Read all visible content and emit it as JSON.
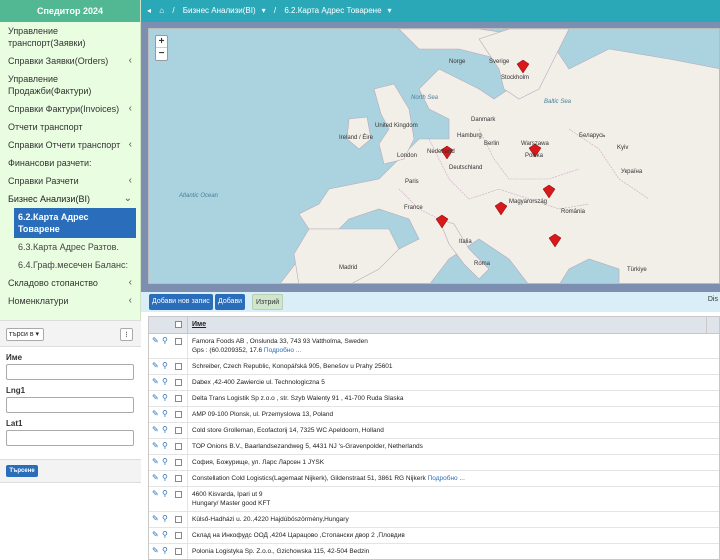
{
  "sidebar": {
    "brand": "Спедитор 2024",
    "items": [
      {
        "label": "Управление транспорт(Заявки)",
        "chevron": false
      },
      {
        "label": "Справки Заявки(Orders)",
        "chevron": true
      },
      {
        "label": "Управление Продажби(Фактури)",
        "chevron": false
      },
      {
        "label": "Справки Фактури(Invoices)",
        "chevron": true
      },
      {
        "label": "Отчети транспорт",
        "chevron": false
      },
      {
        "label": "Справки Отчети транспорт",
        "chevron": true
      },
      {
        "label": "Финансови разчети:",
        "chevron": false
      },
      {
        "label": "Справки Разчети",
        "chevron": true
      },
      {
        "label": "Бизнес Анализи(BI)",
        "chevron": true
      }
    ],
    "subitems": [
      {
        "label": "6.2.Карта Адрес Товарене",
        "active": true
      },
      {
        "label": "6.3.Карта Адрес Разтов.",
        "active": false
      },
      {
        "label": "6.4.Граф.месечен Баланс:",
        "active": false
      }
    ],
    "after_items": [
      {
        "label": "Складово стопанство",
        "chevron": true
      },
      {
        "label": "Номенклатури",
        "chevron": true
      }
    ]
  },
  "filter": {
    "select_value": "търси в",
    "labels": [
      "Име",
      "Lng1",
      "Lat1"
    ],
    "search_button": "Търсене"
  },
  "topbar": {
    "breadcrumb_1": "Бизнес Анализи(BI)",
    "breadcrumb_2": "6.2.Карта Адрес Товарене"
  },
  "map": {
    "cities": [
      {
        "name": "Stockholm"
      },
      {
        "name": "Danmark"
      },
      {
        "name": "Hamburg"
      },
      {
        "name": "Berlin"
      },
      {
        "name": "Nederland"
      },
      {
        "name": "London"
      },
      {
        "name": "Polska"
      },
      {
        "name": "Kyiv"
      },
      {
        "name": "Warszawa"
      },
      {
        "name": "Paris"
      },
      {
        "name": "France"
      },
      {
        "name": "Deutschland"
      },
      {
        "name": "Magyarország"
      },
      {
        "name": "România"
      },
      {
        "name": "Italia"
      },
      {
        "name": "Roma"
      },
      {
        "name": "Madrid"
      },
      {
        "name": "Türkiye"
      },
      {
        "name": "Ireland / Éire"
      },
      {
        "name": "United Kingdom"
      },
      {
        "name": "Беларусь"
      },
      {
        "name": "Україна"
      },
      {
        "name": "Sverige"
      },
      {
        "name": "Norge"
      }
    ],
    "seas": [
      {
        "name": "North Sea"
      },
      {
        "name": "Atlantic Ocean"
      },
      {
        "name": "Baltic Sea"
      }
    ]
  },
  "toolbar": {
    "add_new": "Добави нов запис",
    "add": "Добави",
    "delete": "Изтрий",
    "right_text": "Dis"
  },
  "grid": {
    "header_name": "Име",
    "rows": [
      {
        "text": "Famora Foods AB , Onslunda 33, 743 93 Vattholma, Sweden",
        "text2": "Gps : (60.0209352, 17.6",
        "link": "Подробно ..."
      },
      {
        "text": "Schreiber, Czech Republic, Konopářská 905, Benešov u Prahy 25601",
        "text2": "",
        "link": ""
      },
      {
        "text": "Dabex ,42-400 Zawiercie ul. Technologiczna 5",
        "text2": "",
        "link": ""
      },
      {
        "text": "Delta Trans Logistik Sp z.o.o , str. Szyb Walenty 91 , 41-700 Ruda Slaska",
        "text2": "",
        "link": ""
      },
      {
        "text": "AMP 09-100 Plonsk, ul. Przemyslowa 13, Poland",
        "text2": "",
        "link": ""
      },
      {
        "text": "Cold store Grolleman, Ecofactorij 14, 7325 WC Apeldoorn, Holland",
        "text2": "",
        "link": ""
      },
      {
        "text": "TOP Onions B.V., Baarlandsezandweg 5, 4431 NJ 's-Gravenpolder, Netherlands",
        "text2": "",
        "link": ""
      },
      {
        "text": "София, Божурище, ул. Ларс Ларсен 1 JYSK",
        "text2": "",
        "link": ""
      },
      {
        "text": "Constellation Cold Logistics(Lagemaat Nijkerk), Gildenstraat 51, 3861 RG Nijkerk",
        "text2": "",
        "link": "Подробно ..."
      },
      {
        "text": "4600 Kisvarda, Ipari ut 9",
        "text2": "Hungary/ Master good KFT",
        "link": ""
      },
      {
        "text": "Külső-Hadházi u. 20.,4220 Hajdúböszörmény,Hungary",
        "text2": "",
        "link": ""
      },
      {
        "text": "Склад на Инкофудс ООД ,4204 Царацово ,Стопански двор 2 ,Пловдив",
        "text2": "",
        "link": ""
      },
      {
        "text": "Polonia Logistyka Sp. Z.o.o., Gzichowska 115, 42-504 Bedzin",
        "text2": "",
        "link": ""
      }
    ]
  },
  "colors": {
    "accent": "#2a6ebb",
    "topbar": "#2aa8b8",
    "brand": "#52b893",
    "sidebar_bg": "#e9fde0",
    "marker": "#d7191c"
  }
}
